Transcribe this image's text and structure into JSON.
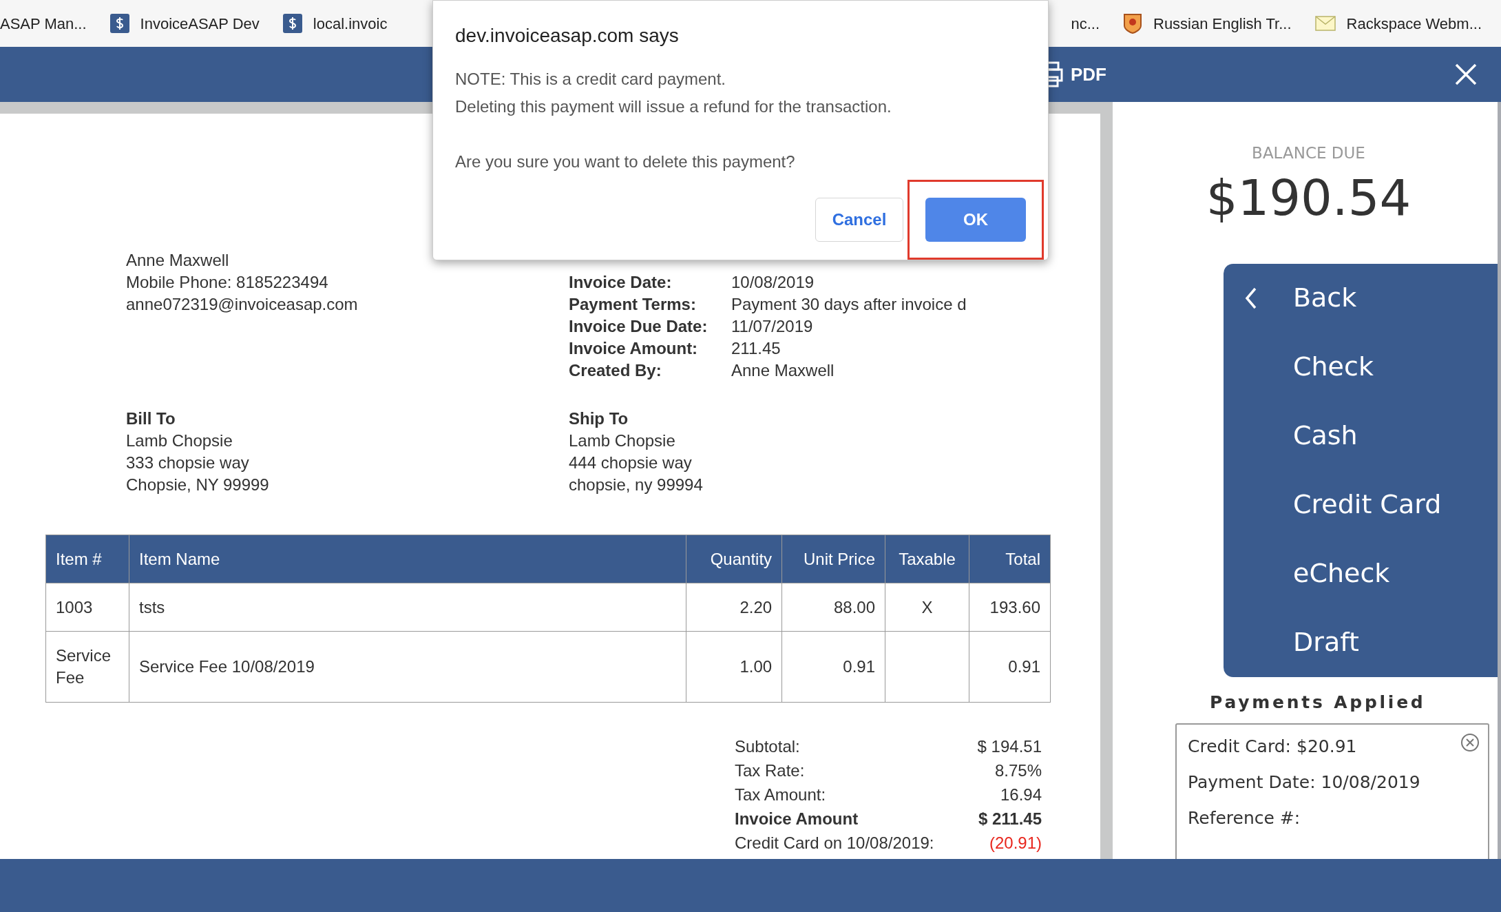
{
  "bookmarks_left": [
    {
      "label": "ASAP Man...",
      "kind": "none"
    },
    {
      "label": "InvoiceASAP Dev",
      "kind": "dollar"
    },
    {
      "label": "local.invoic",
      "kind": "dollar"
    }
  ],
  "bookmarks_right": [
    {
      "label": "nc...",
      "kind": "none"
    },
    {
      "label": "Russian English Tr...",
      "kind": "badge"
    },
    {
      "label": "Rackspace Webm...",
      "kind": "envelope"
    }
  ],
  "header": {
    "pdf_label": "PDF"
  },
  "dialog": {
    "title": "dev.invoiceasap.com says",
    "lines": [
      "NOTE: This is a credit card payment.",
      "Deleting this payment will issue a refund for the transaction."
    ],
    "question": "Are you sure you want to delete this payment?",
    "buttons": [
      {
        "label": "Cancel",
        "kind": "secondary",
        "highlighted": false
      },
      {
        "label": "OK",
        "kind": "primary",
        "highlighted": true
      }
    ]
  },
  "invoice": {
    "sender": [
      "Anne Maxwell",
      "Mobile Phone: 8185223494",
      "anne072319@invoiceasap.com"
    ],
    "details": [
      {
        "label": "Invoice Date:",
        "value": "10/08/2019"
      },
      {
        "label": "Payment Terms:",
        "value": "Payment 30 days after invoice d"
      },
      {
        "label": "Invoice Due Date:",
        "value": "11/07/2019"
      },
      {
        "label": "Invoice Amount:",
        "value": "211.45"
      },
      {
        "label": "Created By:",
        "value": "Anne Maxwell"
      }
    ],
    "bill_to": {
      "heading": "Bill To",
      "lines": [
        "Lamb Chopsie",
        "333 chopsie way",
        "Chopsie, NY 99999"
      ]
    },
    "ship_to": {
      "heading": "Ship To",
      "lines": [
        "Lamb Chopsie",
        "444 chopsie way",
        "chopsie, ny 99994"
      ]
    },
    "table": {
      "columns": [
        {
          "label": "Item #"
        },
        {
          "label": "Item Name"
        },
        {
          "label": "Quantity"
        },
        {
          "label": "Unit Price"
        },
        {
          "label": "Taxable"
        },
        {
          "label": "Total"
        }
      ],
      "rows": [
        [
          "1003",
          "tsts",
          "2.20",
          "88.00",
          "X",
          "193.60"
        ],
        [
          "Service Fee",
          "Service Fee 10/08/2019",
          "1.00",
          "0.91",
          "",
          "0.91"
        ]
      ]
    },
    "totals": [
      {
        "label": "Subtotal:",
        "value": "$ 194.51",
        "kind": "normal"
      },
      {
        "label": "Tax Rate:",
        "value": "8.75%",
        "kind": "normal"
      },
      {
        "label": "Tax Amount:",
        "value": "16.94",
        "kind": "normal"
      },
      {
        "label": "Invoice Amount",
        "value": "$ 211.45",
        "kind": "bold"
      },
      {
        "label": "Credit Card on 10/08/2019:",
        "value": "(20.91)",
        "kind": "credit"
      }
    ]
  },
  "balance": {
    "label": "BALANCE DUE",
    "amount": "$190.54"
  },
  "payment_methods": [
    {
      "label": "Back",
      "kind": "back"
    },
    {
      "label": "Check",
      "kind": "method"
    },
    {
      "label": "Cash",
      "kind": "method"
    },
    {
      "label": "Credit Card",
      "kind": "method"
    },
    {
      "label": "eCheck",
      "kind": "method"
    },
    {
      "label": "Draft",
      "kind": "method"
    }
  ],
  "payments_applied": {
    "title": "Payments Applied",
    "items": [
      {
        "lines": [
          "Credit Card: $20.91",
          "Payment Date: 10/08/2019",
          "Reference #:"
        ]
      }
    ]
  }
}
